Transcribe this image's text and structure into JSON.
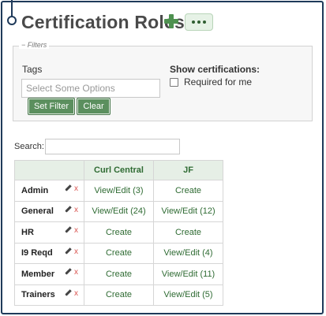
{
  "page": {
    "title": "Certification Roles"
  },
  "filters": {
    "legend": "Filters",
    "tags_label": "Tags",
    "tags_placeholder": "Select Some Options",
    "set_filter_label": "Set Filter",
    "clear_label": "Clear",
    "show_certifications_label": "Show certifications:",
    "required_for_me_label": "Required for me",
    "required_for_me_checked": false
  },
  "search": {
    "label": "Search:",
    "value": ""
  },
  "table": {
    "columns": [
      "",
      "Curl Central",
      "JF"
    ],
    "rows": [
      {
        "name": "Admin",
        "curl_central": "View/Edit (3)",
        "jf": "Create"
      },
      {
        "name": "General",
        "curl_central": "View/Edit (24)",
        "jf": "View/Edit (12)"
      },
      {
        "name": "HR",
        "curl_central": "Create",
        "jf": "Create"
      },
      {
        "name": "I9 Reqd",
        "curl_central": "Create",
        "jf": "View/Edit (4)"
      },
      {
        "name": "Member",
        "curl_central": "Create",
        "jf": "View/Edit (11)"
      },
      {
        "name": "Trainers",
        "curl_central": "Create",
        "jf": "View/Edit (5)"
      }
    ],
    "delete_glyph": "x"
  },
  "colors": {
    "accent_green": "#5b8f5e",
    "link_green": "#2f6b33",
    "delete_red": "#d9534f",
    "frame_navy": "#1f3a5a"
  },
  "icons": [
    "plus-icon",
    "more-icon",
    "edit-icon",
    "delete-icon"
  ]
}
